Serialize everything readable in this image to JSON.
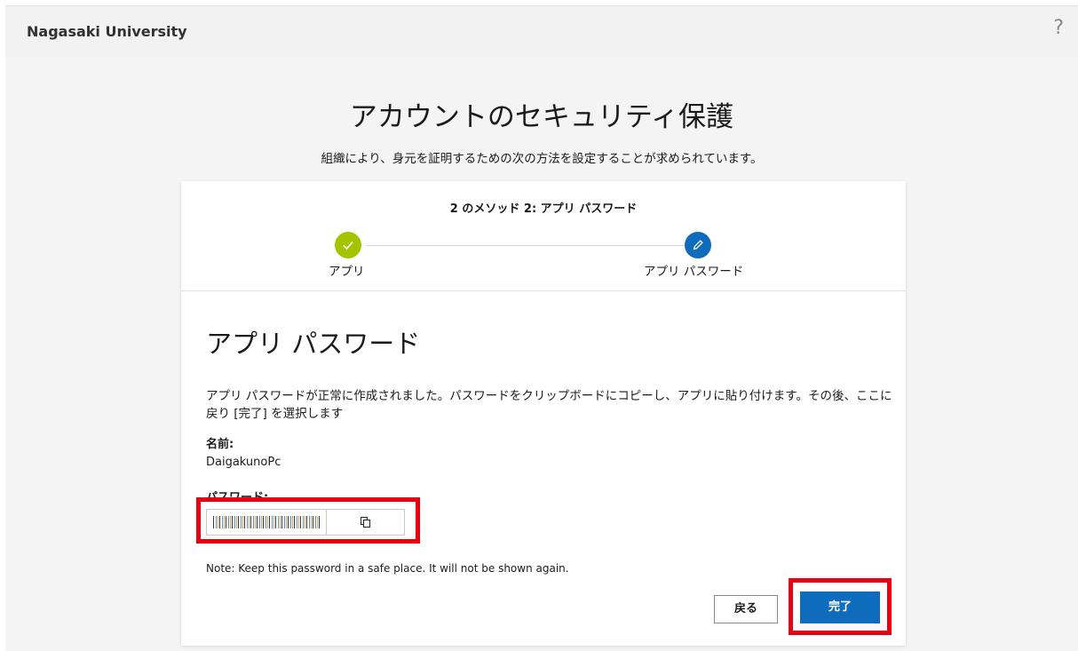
{
  "header": {
    "org_name": "Nagasaki University",
    "help_label": "?"
  },
  "main": {
    "title": "アカウントのセキュリティ保護",
    "subtitle": "組織により、身元を証明するための次の方法を設定することが求められています。"
  },
  "wizard": {
    "step_label": "2 のメソッド 2: アプリ パスワード",
    "steps": [
      {
        "label": "アプリ",
        "state": "complete",
        "icon": "check-icon"
      },
      {
        "label": "アプリ パスワード",
        "state": "current",
        "icon": "pencil-icon"
      }
    ]
  },
  "content": {
    "section_title": "アプリ パスワード",
    "description": "アプリ パスワードが正常に作成されました。パスワードをクリップボードにコピーし、アプリに貼り付けます。その後、ここに戻り [完了] を選択します",
    "name_label": "名前:",
    "name_value": "DaigakunoPc",
    "password_label": "パスワード:",
    "copy_icon": "copy-icon",
    "note": "Note: Keep this password in a safe place. It will not be shown again."
  },
  "buttons": {
    "back": "戻る",
    "done": "完了"
  },
  "colors": {
    "complete_step": "#a4c400",
    "current_step": "#0f6cbd",
    "primary_button": "#0f6cbd",
    "highlight": "#e60012"
  }
}
